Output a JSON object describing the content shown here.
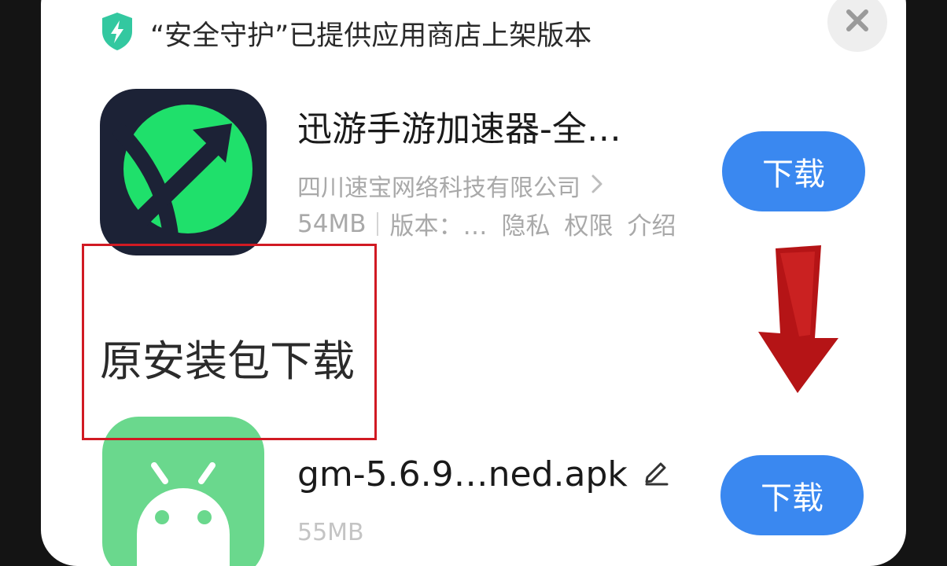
{
  "notice": {
    "text": "“安全守护”已提供应用商店上架版本"
  },
  "app": {
    "name": "迅游手游加速器-全…",
    "developer": "四川速宝网络科技有限公司",
    "size": "54MB",
    "version": "版本：…",
    "privacy_link": "隐私",
    "permissions_link": "权限",
    "intro_link": "介绍",
    "download_label": "下载"
  },
  "annotation": {
    "label": "原安装包下载"
  },
  "apk": {
    "filename": "gm-5.6.9…ned.apk",
    "size": "55MB",
    "download_label": "下载"
  },
  "colors": {
    "accent": "#3a88f0",
    "shield": "#33c8a0",
    "annotation_red": "#d11a23",
    "app_icon_bg": "#1c2236",
    "app_icon_green": "#1fe06b",
    "android_green": "#6ad88d"
  },
  "icons": {
    "shield": "shield-bolt-icon",
    "close": "close-icon",
    "chevron": "chevron-right-icon",
    "edit": "pencil-edit-icon",
    "arrow": "down-arrow-annotation-icon"
  }
}
